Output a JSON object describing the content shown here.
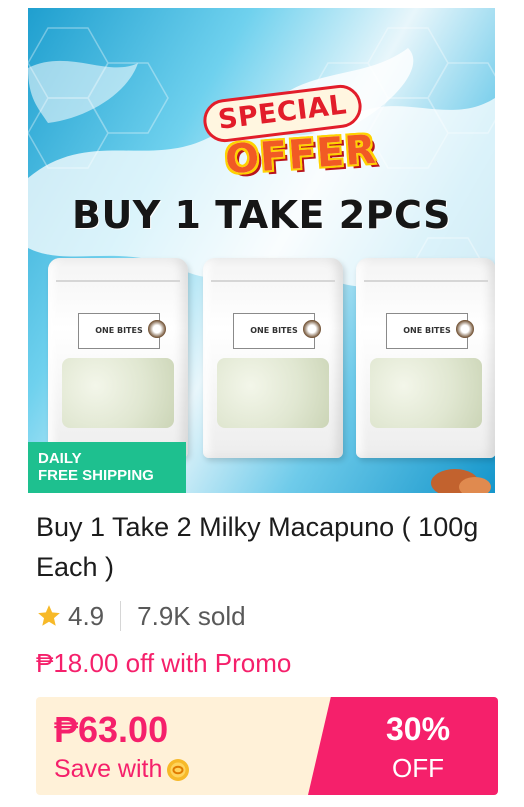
{
  "product": {
    "image": {
      "badge_line1": "SPECIAL",
      "badge_line2": "OFFER",
      "headline": "BUY 1 TAKE 2PCS",
      "pouch_label": "ONE BITES"
    },
    "shipping_badge": {
      "line1": "DAILY",
      "line2": "FREE SHIPPING"
    },
    "title": "Buy 1 Take 2 Milky Macapuno ( 100g Each )",
    "rating": "4.9",
    "sold": "7.9K sold",
    "promo": "₱18.00 off with Promo",
    "price": "₱63.00",
    "save_with": "Save with",
    "discount_percent": "30%",
    "discount_off": "OFF"
  },
  "colors": {
    "accent": "#f5206b",
    "shipping_badge": "#1ec08f",
    "price_bar_bg": "#fff1d8",
    "star": "#f7b928"
  },
  "icons": {
    "star": "star-icon",
    "coin": "coin-icon"
  }
}
